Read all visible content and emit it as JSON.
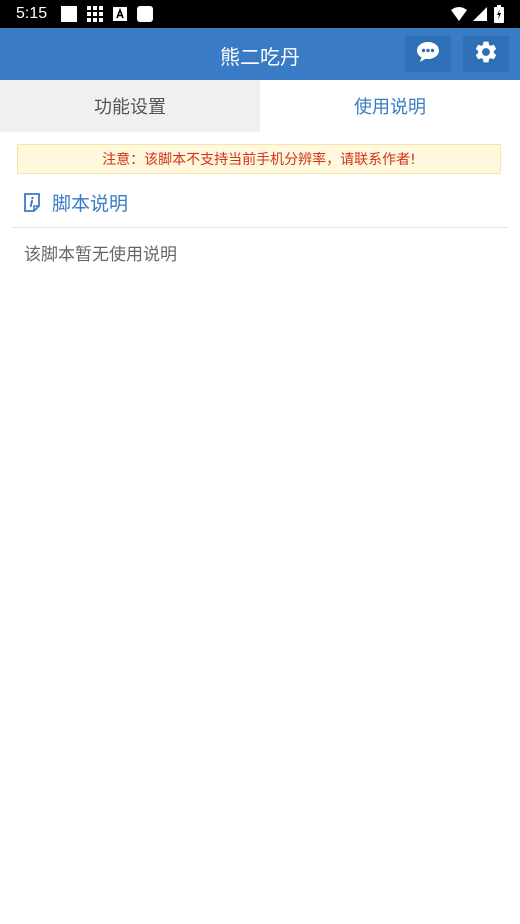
{
  "status_bar": {
    "time": "5:15"
  },
  "app_bar": {
    "title": "熊二吃丹"
  },
  "tabs": [
    {
      "label": "功能设置",
      "active": false
    },
    {
      "label": "使用说明",
      "active": true
    }
  ],
  "notice": {
    "text": "注意：该脚本不支持当前手机分辨率，请联系作者!"
  },
  "section": {
    "title": "脚本说明",
    "content": "该脚本暂无使用说明"
  },
  "colors": {
    "primary": "#3a7bc6",
    "warning_text": "#d2321e",
    "warning_bg": "#fff8dc"
  }
}
